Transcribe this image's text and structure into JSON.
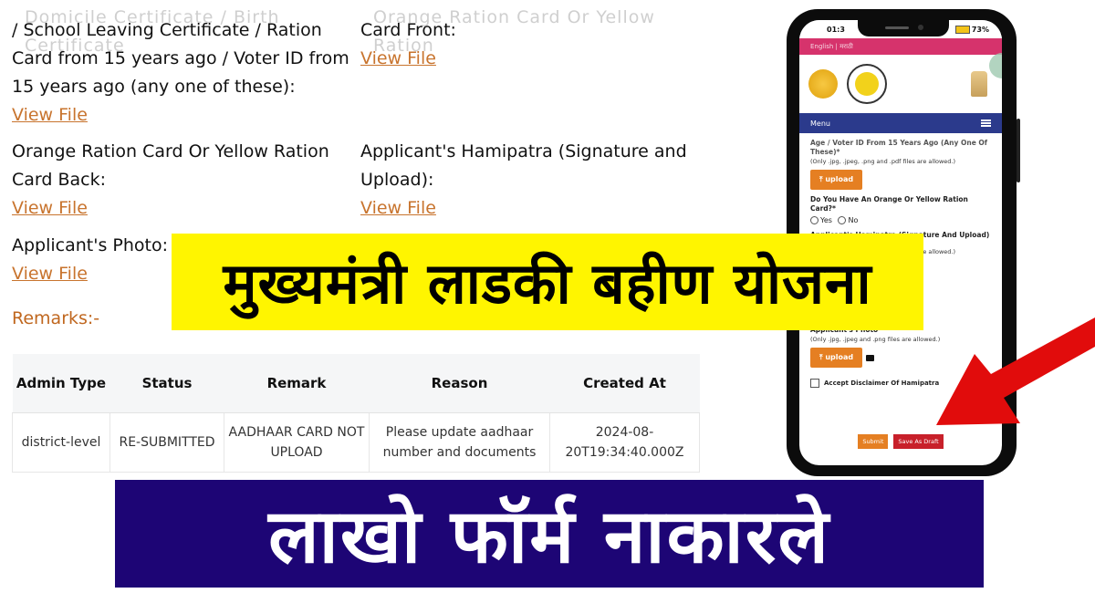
{
  "document": {
    "fields": [
      {
        "cut_label": "Domicile Certificate / Birth Certificate",
        "label": "/ School Leaving Certificate / Ration Card from 15 years ago / Voter ID from 15 years ago (any one of these):",
        "link": "View File"
      },
      {
        "cut_label": "Orange Ration Card Or Yellow Ration",
        "label": "Card Front:",
        "link": "View File"
      },
      {
        "label": "Orange Ration Card Or Yellow Ration Card Back:",
        "link": "View File"
      },
      {
        "label": "Applicant's Hamipatra (Signature and Upload):",
        "link": "View File"
      },
      {
        "label": "Applicant's Photo:",
        "link": "View File"
      }
    ],
    "remarks_label": "Remarks:-",
    "table": {
      "headers": [
        "Admin Type",
        "Status",
        "Remark",
        "Reason",
        "Created At"
      ],
      "rows": [
        [
          "district-level",
          "RE-SUBMITTED",
          "AADHAAR CARD NOT UPLOAD",
          "Please update aadhaar number and documents",
          "2024-08-20T19:34:40.000Z"
        ]
      ]
    }
  },
  "banners": {
    "title": "मुख्यमंत्री लाडकी बहीण योजना",
    "subtitle": "लाखो फॉर्म नाकारले",
    "title_bg": "#fff500",
    "subtitle_bg": "#1d0575"
  },
  "phone": {
    "time": "01:3",
    "battery": "73%",
    "languages": "English | मराठी",
    "menu_label": "Menu",
    "form": {
      "q1_tail": "Age / Voter ID From 15 Years Ago (Any One Of These)*",
      "q1_hint": "(Only .jpg, .jpeg, .png and .pdf files are allowed.)",
      "upload_label": "upload",
      "q2": "Do You Have An Orange Or Yellow Ration Card?*",
      "yes": "Yes",
      "no": "No",
      "q3": "Applicant's Hamipatra (Signature And Upload)",
      "q3_hint": "(Only .jpg, .jpeg, .png and .pdf files are allowed.)",
      "q4": "Applicant's Photo*",
      "q4_hint": "(Only .jpg, .jpeg and .png files are allowed.)",
      "disclaimer": "Accept Disclaimer Of Hamipatra",
      "submit": "Submit",
      "save_draft": "Save As Draft"
    }
  },
  "colors": {
    "link": "#c8742e",
    "remarks": "#c0671f",
    "arrow": "#e10c0c",
    "upload_button": "#e57f22",
    "draft_button": "#c8202a",
    "menu_bar": "#2b3a8c",
    "lang_bar": "#d6336c"
  }
}
